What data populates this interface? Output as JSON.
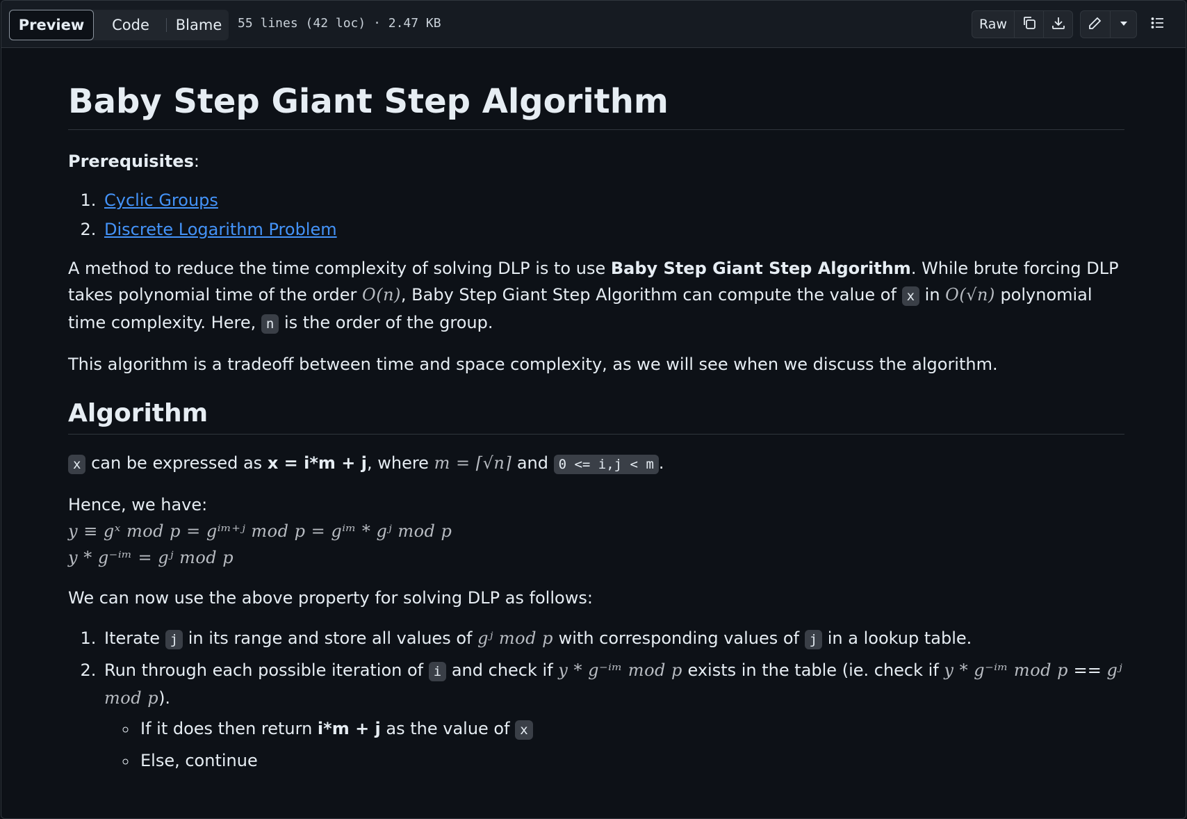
{
  "toolbar": {
    "tabs": [
      "Preview",
      "Code",
      "Blame"
    ],
    "file_info": "55 lines (42 loc) · 2.47 KB",
    "raw_label": "Raw",
    "icons": [
      "copy-icon",
      "download-icon",
      "pencil-icon",
      "triangle-down-icon",
      "list-icon"
    ]
  },
  "doc": {
    "title": "Baby Step Giant Step Algorithm",
    "prereq_label": "Prerequisites",
    "prereq_colon": ":",
    "prereqs": [
      "Cyclic Groups",
      "Discrete Logarithm Problem"
    ],
    "para1": {
      "t1": "A method to reduce the time complexity of solving DLP is to use ",
      "bold": "Baby Step Giant Step Algorithm",
      "t2": ". While brute forcing DLP takes polynomial time of the order ",
      "math1": "O(n)",
      "t3": ", Baby Step Giant Step Algorithm can compute the value of ",
      "code_x": "x",
      "t4": " in ",
      "math2": "O(√n)",
      "t5": " polynomial time complexity. Here, ",
      "code_n": "n",
      "t6": " is the order of the group."
    },
    "para2": "This algorithm is a tradeoff between time and space complexity, as we will see when we discuss the algorithm.",
    "algorithm_heading": "Algorithm",
    "para3": {
      "code_x": "x",
      "t1": " can be expressed as ",
      "bold": "x = i*m + j",
      "t2": ", where ",
      "math": "m = ⌈√n⌉",
      "t3": " and ",
      "code_range": "0 <= i,j < m",
      "t4": "."
    },
    "hence": "Hence, we have:",
    "eq1": "y ≡ gˣ mod p = gⁱᵐ⁺ʲ mod p = gⁱᵐ * gʲ mod p",
    "eq2": "y * g⁻ⁱᵐ = gʲ mod p",
    "para4": "We can now use the above property for solving DLP as follows:",
    "steps": {
      "s1": {
        "t1": "Iterate ",
        "code_j": "j",
        "t2": " in its range and store all values of ",
        "math": "gʲ mod p",
        "t3": " with corresponding values of ",
        "code_j2": "j",
        "t4": " in a lookup table."
      },
      "s2": {
        "t1": "Run through each possible iteration of ",
        "code_i": "i",
        "t2": " and check if ",
        "math1": "y * g⁻ⁱᵐ mod p",
        "t3": " exists in the table (ie. check if ",
        "math2": "y * g⁻ⁱᵐ mod p",
        "t4": " == ",
        "math3": "gʲ mod p",
        "t5": ")."
      },
      "sub1": {
        "t1": "If it does then return ",
        "bold": "i*m + j",
        "t2": " as the value of ",
        "code_x": "x"
      },
      "sub2": "Else, continue"
    }
  },
  "colors": {
    "background": "#0d1117",
    "text": "#e6edf3",
    "link": "#4493f8",
    "border": "#30363d",
    "toolbar": "#161b22"
  }
}
